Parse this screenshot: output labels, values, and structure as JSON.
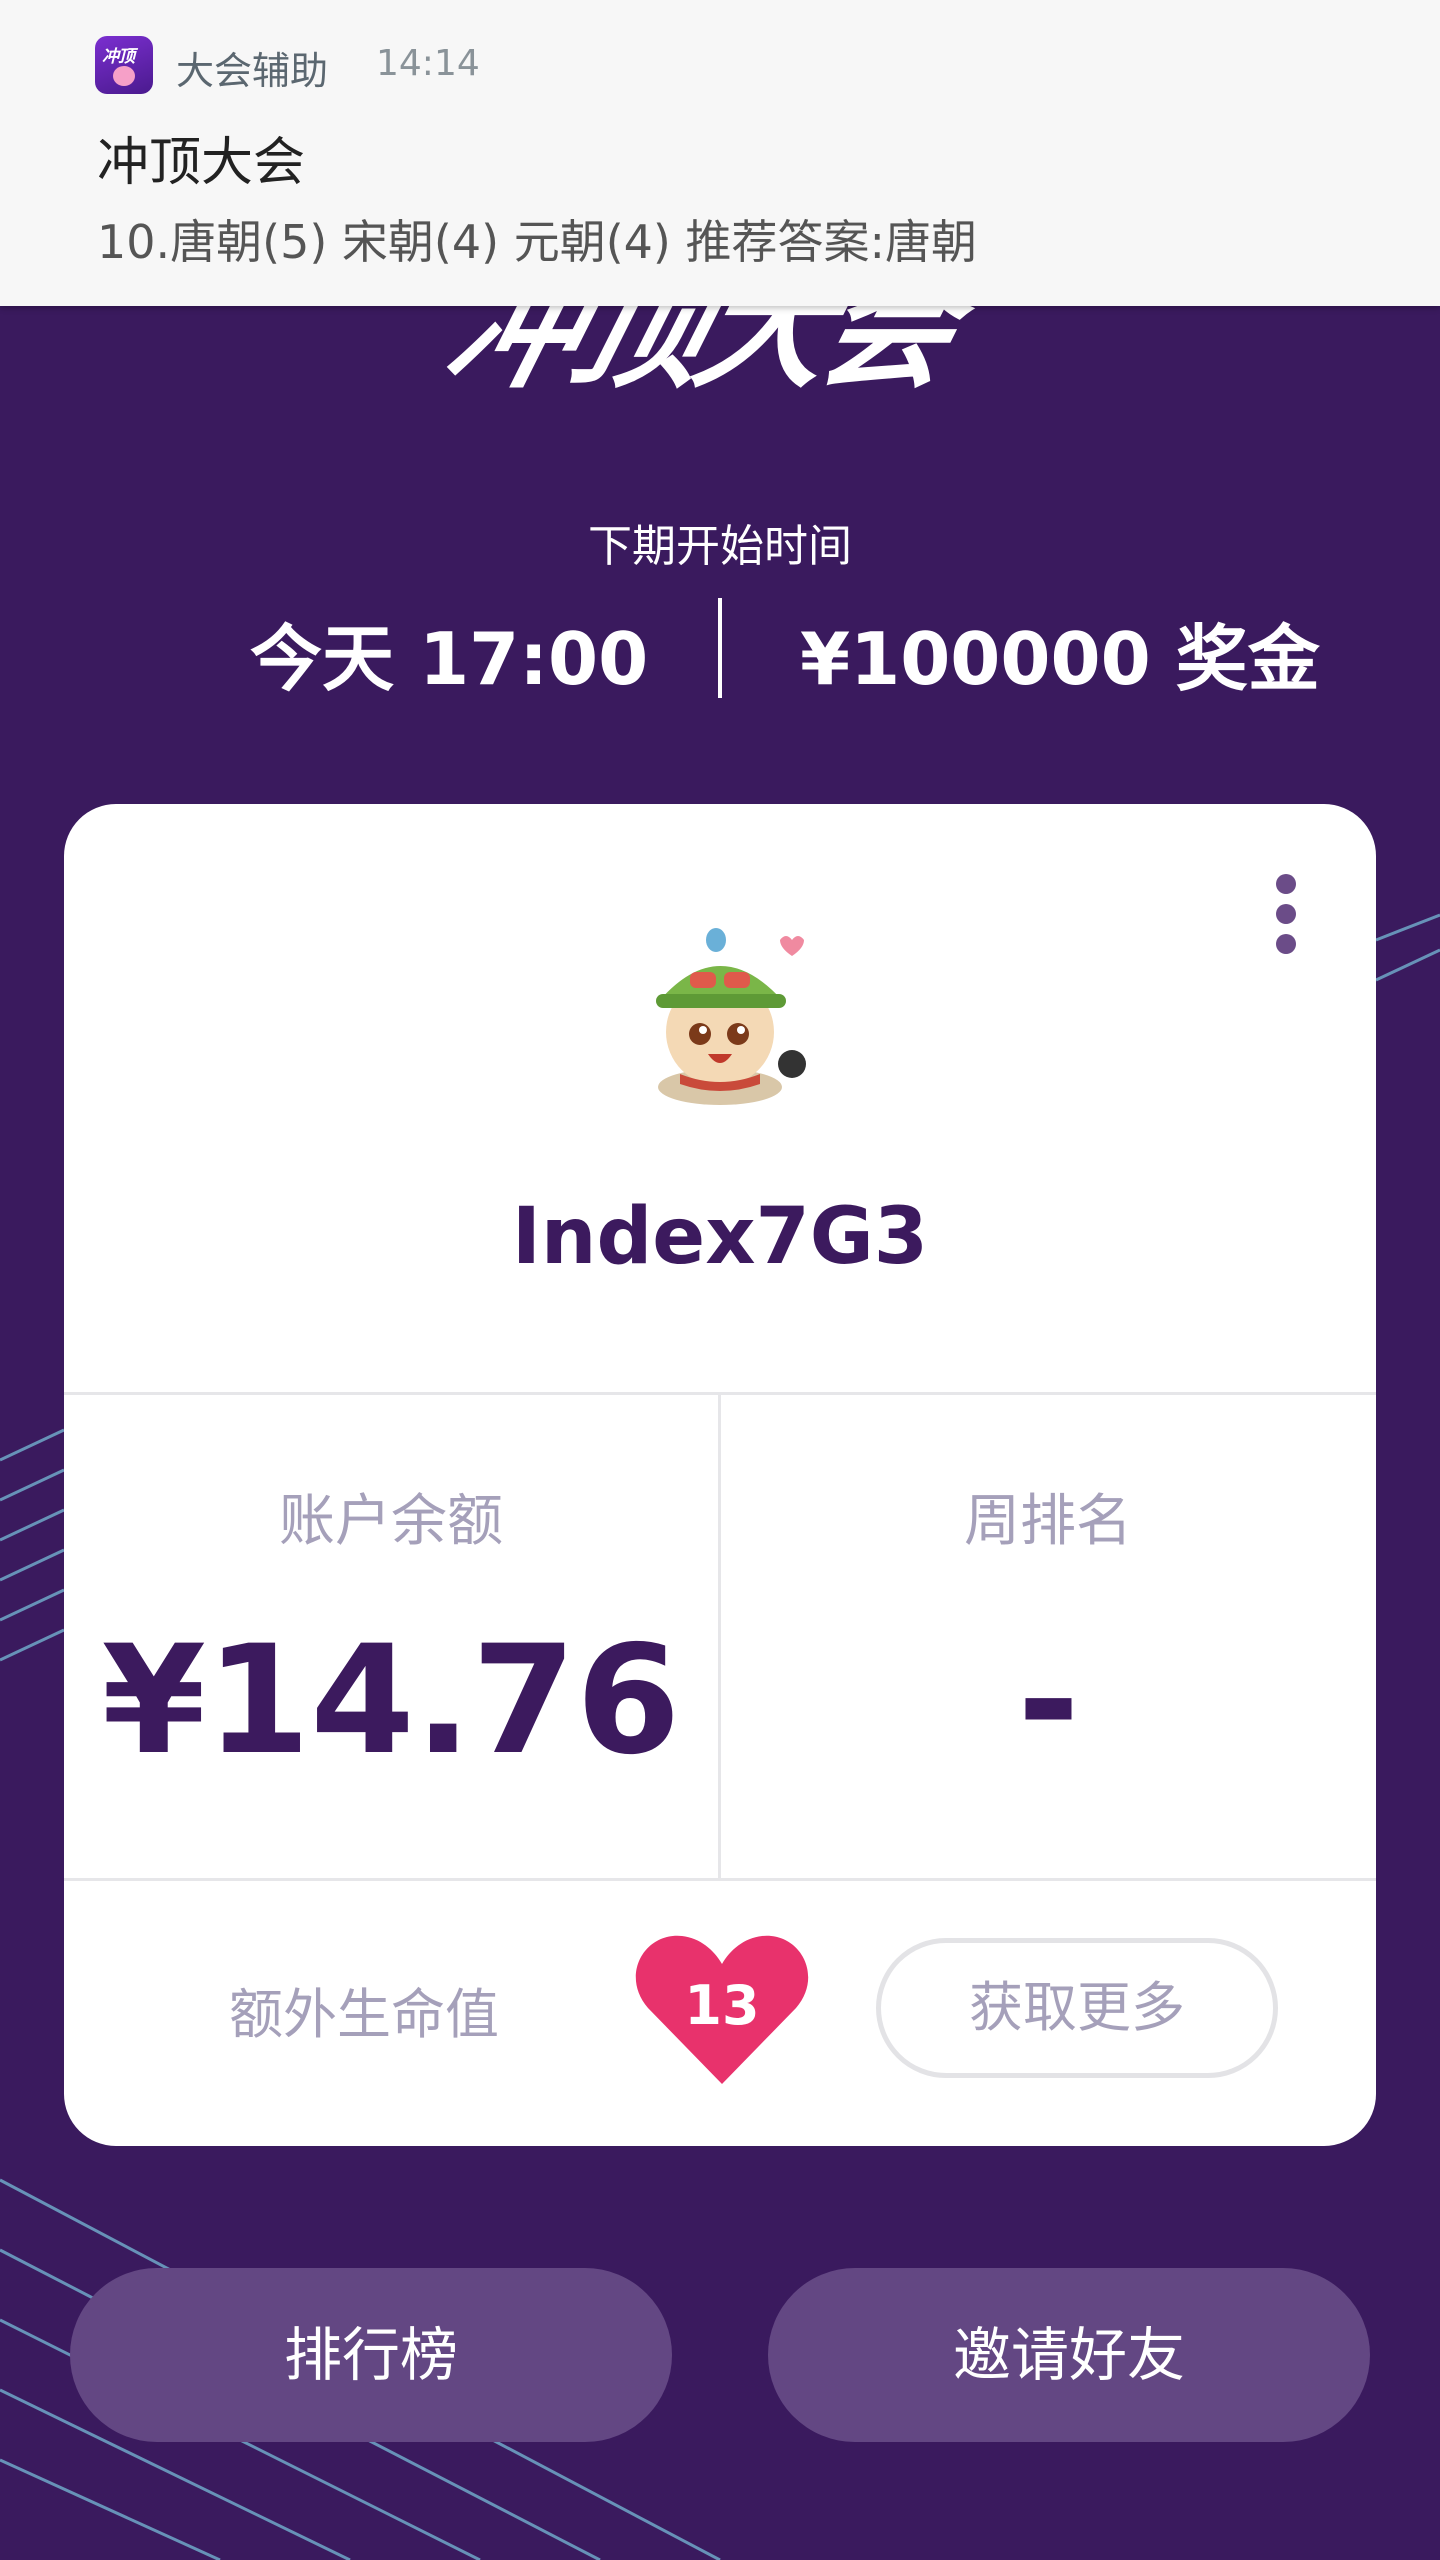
{
  "notification": {
    "app_name": "大会辅助",
    "time": "14:14",
    "title": "冲顶大会",
    "body": "10.唐朝(5) 宋朝(4) 元朝(4) 推荐答案:唐朝",
    "icon_text": "冲顶"
  },
  "header": {
    "logo_text": "冲顶大会",
    "next_label": "下期开始时间",
    "next_time": "今天 17:00",
    "prize": "¥100000 奖金"
  },
  "profile": {
    "username": "Index7G3",
    "balance_label": "账户余额",
    "balance_value": "¥14.76",
    "rank_label": "周排名",
    "rank_value": "-",
    "lives_label": "额外生命值",
    "lives_count": "13",
    "get_more_label": "获取更多"
  },
  "actions": {
    "leaderboard_label": "排行榜",
    "invite_label": "邀请好友"
  },
  "colors": {
    "background": "#3a1a5e",
    "primary_text": "#3c1a5e",
    "muted_text": "#a5a0ba",
    "heart": "#e8326c",
    "button_bg": "#634783"
  }
}
